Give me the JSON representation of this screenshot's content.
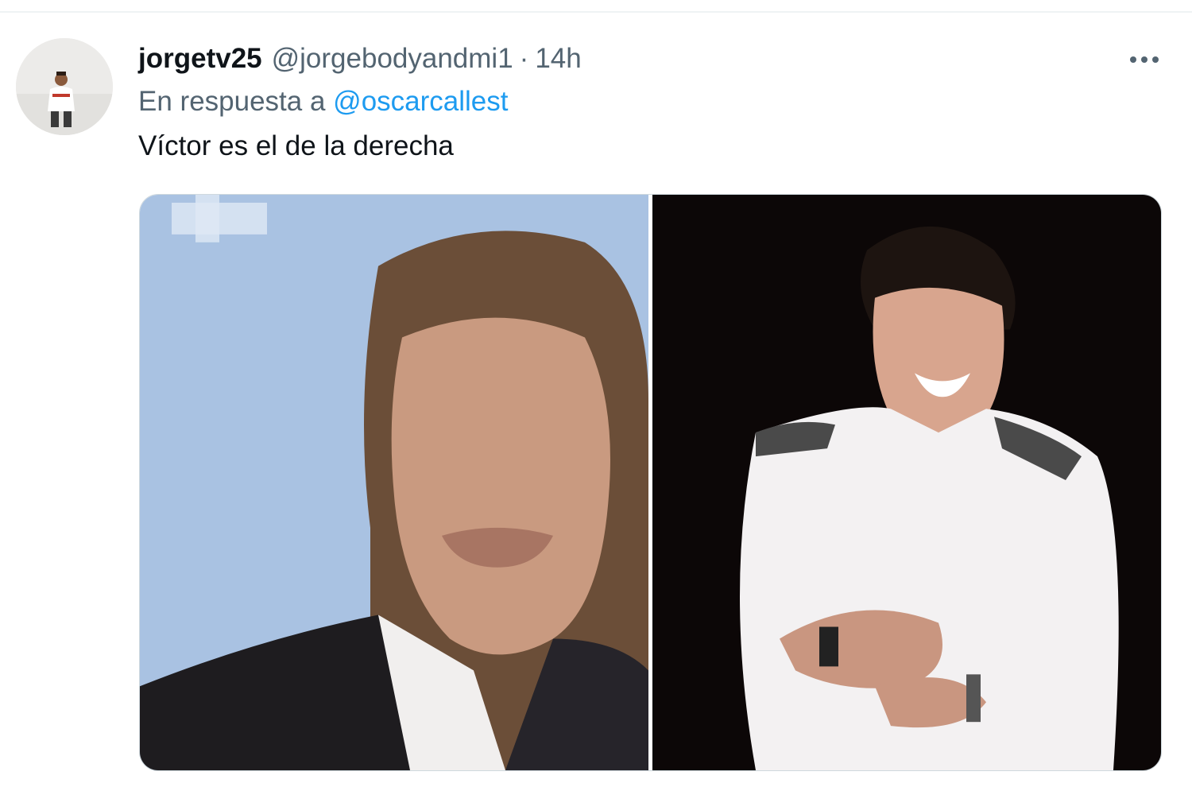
{
  "tweet": {
    "display_name": "jorgetv25",
    "handle": "@jorgebodyandmi1",
    "separator": "·",
    "timestamp": "14h",
    "reply_prefix": "En respuesta a",
    "reply_mention": "@oscarcallest",
    "text": "Víctor es el de la derecha",
    "more_icon": "more-horizontal-icon"
  },
  "media": {
    "photos": [
      {
        "id": "photo-left",
        "description_icon": "man-portrait-photo",
        "background": "#a7c1e2"
      },
      {
        "id": "photo-right",
        "description_icon": "man-smiling-photo",
        "background": "#0b0707"
      }
    ]
  },
  "colors": {
    "text_primary": "#0f1419",
    "text_secondary": "#536471",
    "link": "#1d9bf0",
    "divider": "#eff3f4"
  }
}
